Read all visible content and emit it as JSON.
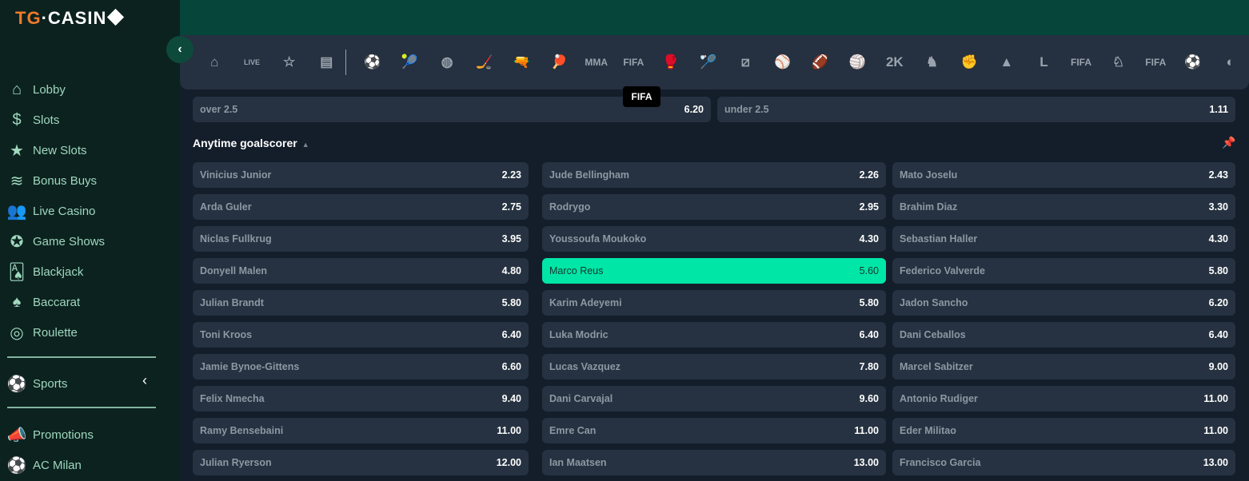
{
  "brand": {
    "part1": "TG",
    "part2": "·CASIN"
  },
  "sidebar": {
    "items": [
      {
        "label": "Lobby",
        "icon": "home-icon",
        "glyph": "⌂"
      },
      {
        "label": "Slots",
        "icon": "dollar-icon",
        "glyph": "$"
      },
      {
        "label": "New Slots",
        "icon": "star-icon",
        "glyph": "★"
      },
      {
        "label": "Bonus Buys",
        "icon": "coins-icon",
        "glyph": "≋"
      },
      {
        "label": "Live Casino",
        "icon": "users-icon",
        "glyph": "👥"
      },
      {
        "label": "Game Shows",
        "icon": "wheel-icon",
        "glyph": "✪"
      },
      {
        "label": "Blackjack",
        "icon": "cards-icon",
        "glyph": "🂡"
      },
      {
        "label": "Baccarat",
        "icon": "spade-icon",
        "glyph": "♠"
      },
      {
        "label": "Roulette",
        "icon": "roulette-icon",
        "glyph": "◎"
      }
    ],
    "sports": {
      "label": "Sports",
      "icon": "soccer-ball-icon",
      "glyph": "⚽"
    },
    "extra": [
      {
        "label": "Promotions",
        "icon": "megaphone-icon",
        "glyph": "📣"
      },
      {
        "label": "AC Milan",
        "icon": "soccer-ball-icon",
        "glyph": "⚽"
      }
    ]
  },
  "toolbar": {
    "icons": [
      {
        "name": "home-icon",
        "glyph": "⌂"
      },
      {
        "name": "live-icon",
        "glyph": "LIVE"
      },
      {
        "name": "star-icon",
        "glyph": "☆"
      },
      {
        "name": "betslip-icon",
        "glyph": "▤"
      }
    ],
    "sports": [
      {
        "name": "soccer-icon",
        "glyph": "⚽",
        "active": true
      },
      {
        "name": "tennis-icon",
        "glyph": "🎾"
      },
      {
        "name": "basketball-icon",
        "glyph": "◍"
      },
      {
        "name": "ice-hockey-icon",
        "glyph": "🏒"
      },
      {
        "name": "counter-strike-icon",
        "glyph": "🔫"
      },
      {
        "name": "table-tennis-icon",
        "glyph": "🏓"
      },
      {
        "name": "mma-icon",
        "glyph": "MMA"
      },
      {
        "name": "fifa-icon",
        "glyph": "FIFA"
      },
      {
        "name": "boxing-icon",
        "glyph": "🥊"
      },
      {
        "name": "badminton-icon",
        "glyph": "🏸"
      },
      {
        "name": "dota-icon",
        "glyph": "⧄"
      },
      {
        "name": "baseball-icon",
        "glyph": "⚾"
      },
      {
        "name": "american-football-icon",
        "glyph": "🏈"
      },
      {
        "name": "volleyball-icon",
        "glyph": "🏐"
      },
      {
        "name": "nba2k-icon",
        "glyph": "2K"
      },
      {
        "name": "horse-racing-icon",
        "glyph": "♞"
      },
      {
        "name": "fist-icon",
        "glyph": "✊"
      },
      {
        "name": "snooker-icon",
        "glyph": "▲"
      },
      {
        "name": "lol-icon",
        "glyph": "L"
      },
      {
        "name": "volta-fifa-icon",
        "glyph": "FIFA"
      },
      {
        "name": "horse-24-icon",
        "glyph": "♘"
      },
      {
        "name": "penalty-fifa-icon",
        "glyph": "FIFA"
      },
      {
        "name": "handball-icon",
        "glyph": "⚽"
      },
      {
        "name": "more-sport-icon",
        "glyph": "◐"
      }
    ],
    "tooltip": "FIFA"
  },
  "over_under": [
    {
      "label": "over 2.5",
      "odds": "6.20"
    },
    {
      "label": "under 2.5",
      "odds": "1.11"
    }
  ],
  "market": {
    "title": "Anytime goalscorer",
    "selected": "Marco Reus",
    "columns": [
      [
        [
          "Vinicius Junior",
          "2.23"
        ],
        [
          "Arda Guler",
          "2.75"
        ],
        [
          "Niclas Fullkrug",
          "3.95"
        ],
        [
          "Donyell Malen",
          "4.80"
        ],
        [
          "Julian Brandt",
          "5.80"
        ],
        [
          "Toni Kroos",
          "6.40"
        ],
        [
          "Jamie Bynoe-Gittens",
          "6.60"
        ],
        [
          "Felix Nmecha",
          "9.40"
        ],
        [
          "Ramy Bensebaini",
          "11.00"
        ],
        [
          "Julian Ryerson",
          "12.00"
        ]
      ],
      [
        [
          "Jude Bellingham",
          "2.26"
        ],
        [
          "Rodrygo",
          "2.95"
        ],
        [
          "Youssoufa Moukoko",
          "4.30"
        ],
        [
          "Marco Reus",
          "5.60"
        ],
        [
          "Karim Adeyemi",
          "5.80"
        ],
        [
          "Luka Modric",
          "6.40"
        ],
        [
          "Lucas Vazquez",
          "7.80"
        ],
        [
          "Dani Carvajal",
          "9.60"
        ],
        [
          "Emre Can",
          "11.00"
        ],
        [
          "Ian Maatsen",
          "13.00"
        ]
      ],
      [
        [
          "Mato Joselu",
          "2.43"
        ],
        [
          "Brahim Diaz",
          "3.30"
        ],
        [
          "Sebastian Haller",
          "4.30"
        ],
        [
          "Federico Valverde",
          "5.80"
        ],
        [
          "Jadon Sancho",
          "6.20"
        ],
        [
          "Dani Ceballos",
          "6.40"
        ],
        [
          "Marcel Sabitzer",
          "9.00"
        ],
        [
          "Antonio Rudiger",
          "11.00"
        ],
        [
          "Eder Militao",
          "11.00"
        ],
        [
          "Francisco Garcia",
          "13.00"
        ]
      ]
    ]
  },
  "colors": {
    "accent": "#00e6a6",
    "brand_orange": "#f07a2a",
    "sidebar": "#0c221e",
    "topbar": "#06453a"
  }
}
